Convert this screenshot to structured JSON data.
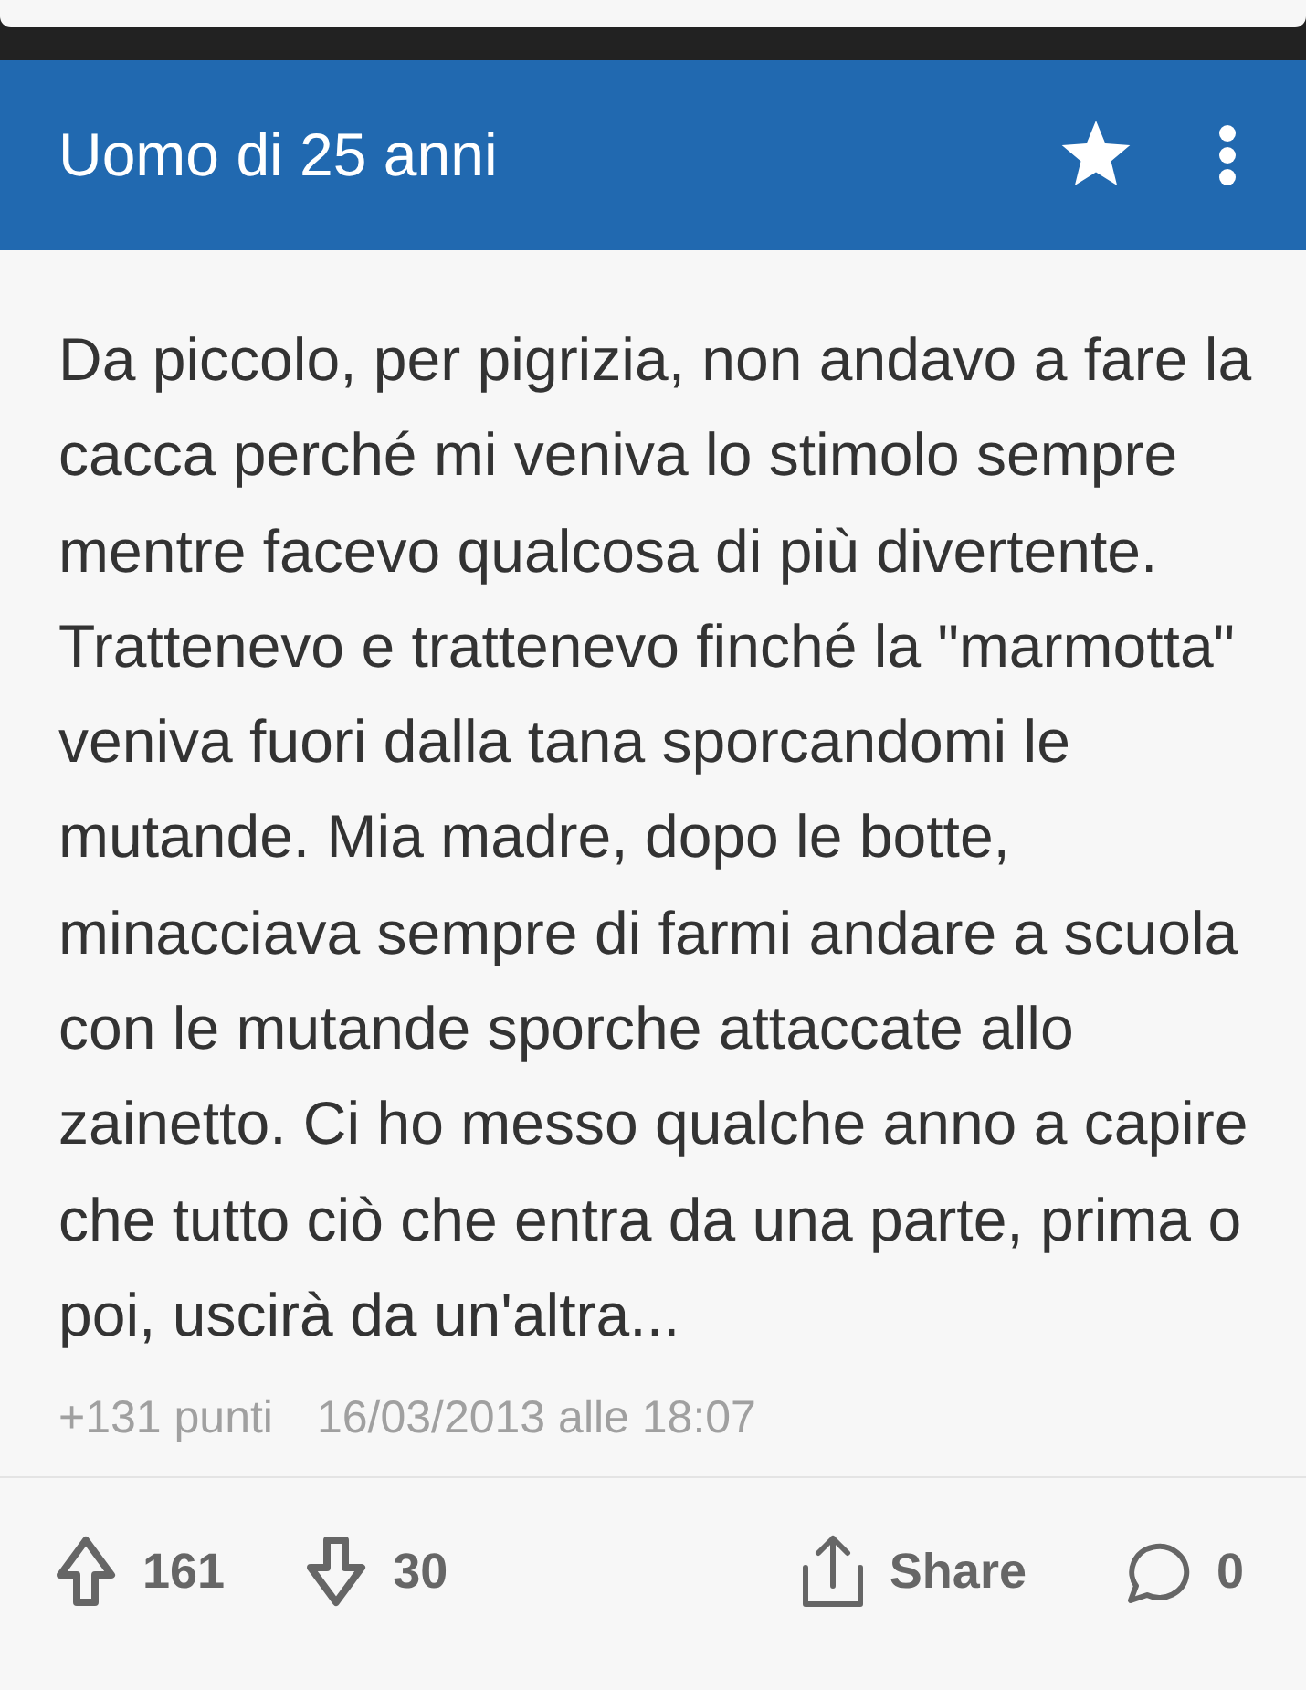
{
  "header": {
    "title": "Uomo di 25 anni"
  },
  "post": {
    "text": "Da piccolo, per pigrizia, non andavo a fare la cacca perché mi veniva lo stimolo sempre mentre facevo qualcosa di più divertente. Trattenevo e trattenevo finché la \"marmotta\" veniva fuori dalla tana sporcandomi le mutande. Mia madre, dopo le botte, minacciava sempre di farmi andare a scuola con le mutande sporche attaccate allo zainetto. Ci ho messo qualche anno a capire che tutto ciò che entra da una parte, prima o poi, uscirà da un'altra...",
    "points": "+131 punti",
    "date": "16/03/2013 alle 18:07"
  },
  "actions": [
    {
      "kind": "upvote",
      "label": "161"
    },
    {
      "kind": "downvote",
      "label": "30"
    },
    {
      "kind": "share",
      "label": "Share"
    },
    {
      "kind": "comment",
      "label": "0"
    }
  ]
}
